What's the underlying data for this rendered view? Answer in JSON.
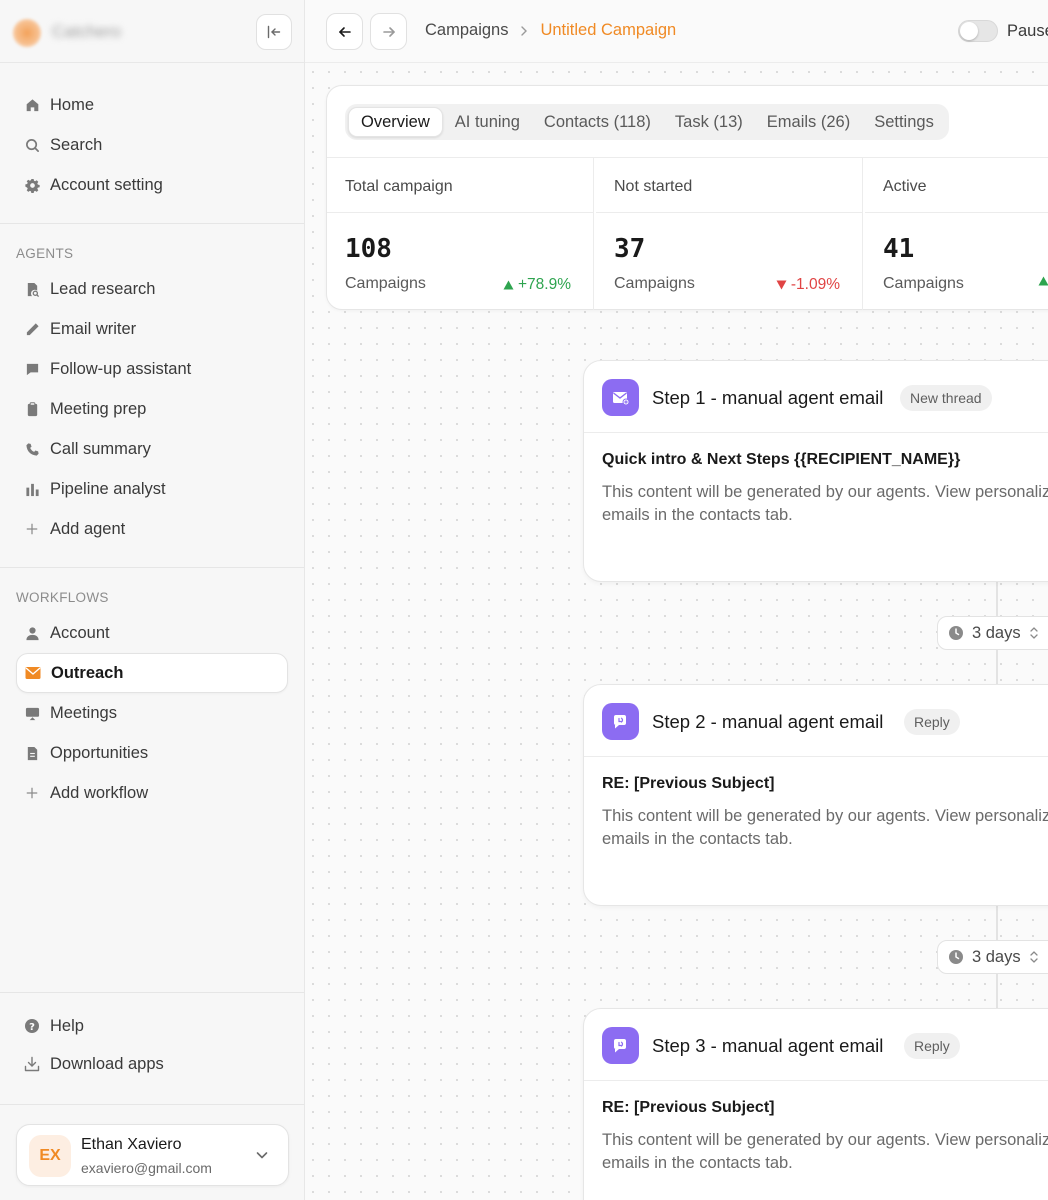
{
  "brand": {
    "name": "Catchero"
  },
  "nav": [
    {
      "label": "Home"
    },
    {
      "label": "Search"
    },
    {
      "label": "Account setting"
    }
  ],
  "agents": {
    "title": "AGENTS",
    "items": [
      {
        "label": "Lead research"
      },
      {
        "label": "Email writer"
      },
      {
        "label": "Follow-up assistant"
      },
      {
        "label": "Meeting prep"
      },
      {
        "label": "Call summary"
      },
      {
        "label": "Pipeline analyst"
      },
      {
        "label": "Add agent"
      }
    ]
  },
  "workflows": {
    "title": "WORKFLOWS",
    "items": [
      {
        "label": "Account"
      },
      {
        "label": "Outreach",
        "active": true
      },
      {
        "label": "Meetings"
      },
      {
        "label": "Opportunities"
      },
      {
        "label": "Add workflow"
      }
    ]
  },
  "bottom": [
    {
      "label": "Help"
    },
    {
      "label": "Download apps"
    }
  ],
  "user": {
    "initials": "EX",
    "name": "Ethan Xaviero",
    "email": "exaviero@gmail.com"
  },
  "breadcrumb": {
    "parent": "Campaigns",
    "current": "Untitled Campaign"
  },
  "pause": {
    "label": "Pause",
    "on": false
  },
  "tabs": [
    {
      "label": "Overview",
      "active": true
    },
    {
      "label": "AI tuning"
    },
    {
      "label": "Contacts (118)"
    },
    {
      "label": "Task (13)"
    },
    {
      "label": "Emails (26)"
    },
    {
      "label": "Settings"
    }
  ],
  "stats": [
    {
      "title": "Total campaign",
      "value": "108",
      "unit": "Campaigns",
      "change": "+78.9%",
      "trend": "up"
    },
    {
      "title": "Not started",
      "value": "37",
      "unit": "Campaigns",
      "change": "-1.09%",
      "trend": "down"
    },
    {
      "title": "Active",
      "value": "41",
      "unit": "Campaigns",
      "change": "",
      "trend": "up"
    }
  ],
  "steps": [
    {
      "title": "Step 1 - manual agent email",
      "badge": "New thread",
      "subject": "Quick intro & Next Steps {{RECIPIENT_NAME}}",
      "body": "This content will be generated by our agents. View personalized emails in the contacts tab."
    },
    {
      "title": "Step 2 - manual agent email",
      "badge": "Reply",
      "subject": "RE: [Previous Subject]",
      "body": "This content will be generated by our agents. View personalized emails in the contacts tab."
    },
    {
      "title": "Step 3 - manual agent email",
      "badge": "Reply",
      "subject": "RE: [Previous Subject]",
      "body": "This content will be generated by our agents. View personalized emails in the contacts tab."
    }
  ],
  "delays": [
    {
      "label": "3 days"
    },
    {
      "label": "3 days"
    }
  ],
  "colors": {
    "accent": "#f08a24",
    "step_icon": "#8c6cf2",
    "up": "#2ea44f",
    "down": "#e04444"
  }
}
